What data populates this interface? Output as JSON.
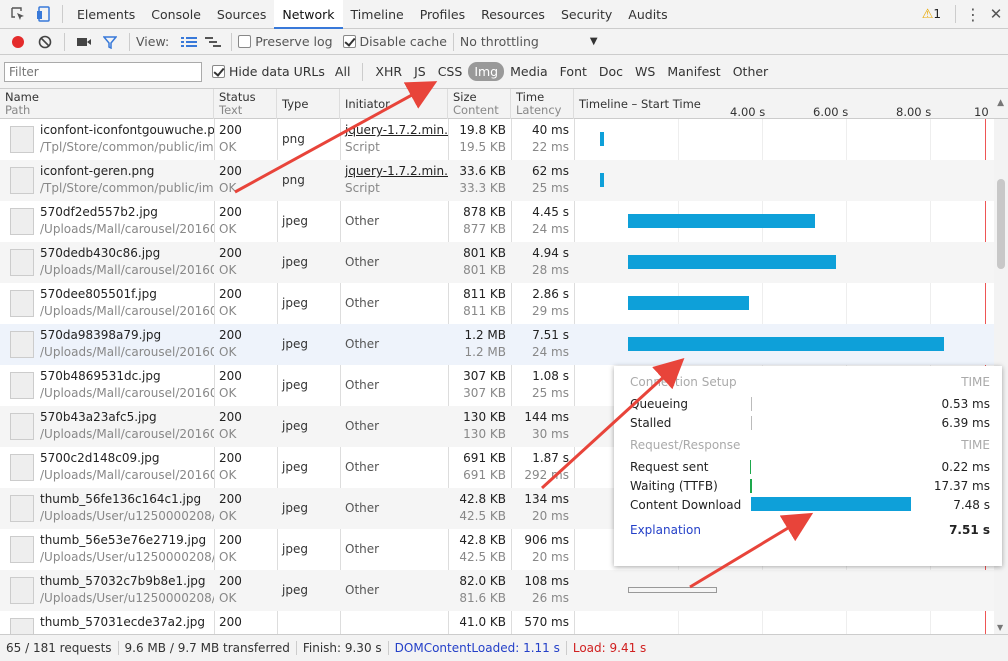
{
  "tabs": {
    "elements": "Elements",
    "console": "Console",
    "sources": "Sources",
    "network": "Network",
    "timeline": "Timeline",
    "profiles": "Profiles",
    "resources": "Resources",
    "security": "Security",
    "audits": "Audits",
    "warning_count": "1"
  },
  "toolbar": {
    "view_label": "View:",
    "preserve_log": "Preserve log",
    "disable_cache": "Disable cache",
    "throttling": "No throttling"
  },
  "filterbar": {
    "placeholder": "Filter",
    "hide_data_urls": "Hide data URLs",
    "types": [
      "All",
      "XHR",
      "JS",
      "CSS",
      "Img",
      "Media",
      "Font",
      "Doc",
      "WS",
      "Manifest",
      "Other"
    ],
    "selected": "Img"
  },
  "columns": {
    "name": "Name",
    "path": "Path",
    "status": "Status",
    "text": "Text",
    "type": "Type",
    "initiator": "Initiator",
    "size": "Size",
    "content": "Content",
    "time": "Time",
    "latency": "Latency",
    "timeline": "Timeline – Start Time",
    "ticks": [
      "4.00 s",
      "6.00 s",
      "8.00 s",
      "10"
    ]
  },
  "rows": [
    {
      "name": "iconfont-iconfontgouwuche.p...",
      "path": "/Tpl/Store/common/public/img",
      "status": "200",
      "text": "OK",
      "type": "png",
      "initiator": "jquery-1.7.2.min....",
      "init_sub": "Script",
      "size": "19.8 KB",
      "content": "19.5 KB",
      "time": "40 ms",
      "latency": "22 ms",
      "bar_start": 0.52,
      "bar_dur": 0.04
    },
    {
      "name": "iconfont-geren.png",
      "path": "/Tpl/Store/common/public/img",
      "status": "200",
      "text": "OK",
      "type": "png",
      "initiator": "jquery-1.7.2.min....",
      "init_sub": "Script",
      "size": "33.6 KB",
      "content": "33.3 KB",
      "time": "62 ms",
      "latency": "25 ms",
      "bar_start": 0.52,
      "bar_dur": 0.06
    },
    {
      "name": "570df2ed557b2.jpg",
      "path": "/Uploads/Mall/carousel/20160...",
      "status": "200",
      "text": "OK",
      "type": "jpeg",
      "initiator": "Other",
      "init_sub": "",
      "size": "878 KB",
      "content": "877 KB",
      "time": "4.45 s",
      "latency": "24 ms",
      "bar_start": 1.2,
      "bar_dur": 4.45
    },
    {
      "name": "570dedb430c86.jpg",
      "path": "/Uploads/Mall/carousel/20160...",
      "status": "200",
      "text": "OK",
      "type": "jpeg",
      "initiator": "Other",
      "init_sub": "",
      "size": "801 KB",
      "content": "801 KB",
      "time": "4.94 s",
      "latency": "28 ms",
      "bar_start": 1.2,
      "bar_dur": 4.94
    },
    {
      "name": "570dee805501f.jpg",
      "path": "/Uploads/Mall/carousel/20160...",
      "status": "200",
      "text": "OK",
      "type": "jpeg",
      "initiator": "Other",
      "init_sub": "",
      "size": "811 KB",
      "content": "811 KB",
      "time": "2.86 s",
      "latency": "29 ms",
      "bar_start": 1.2,
      "bar_dur": 2.86
    },
    {
      "name": "570da98398a79.jpg",
      "path": "/Uploads/Mall/carousel/20160...",
      "status": "200",
      "text": "OK",
      "type": "jpeg",
      "initiator": "Other",
      "init_sub": "",
      "size": "1.2 MB",
      "content": "1.2 MB",
      "time": "7.51 s",
      "latency": "24 ms",
      "bar_start": 1.2,
      "bar_dur": 7.51
    },
    {
      "name": "570b4869531dc.jpg",
      "path": "/Uploads/Mall/carousel/20160...",
      "status": "200",
      "text": "OK",
      "type": "jpeg",
      "initiator": "Other",
      "init_sub": "",
      "size": "307 KB",
      "content": "307 KB",
      "time": "1.08 s",
      "latency": "25 ms",
      "bar_start": null,
      "bar_dur": null
    },
    {
      "name": "570b43a23afc5.jpg",
      "path": "/Uploads/Mall/carousel/20160...",
      "status": "200",
      "text": "OK",
      "type": "jpeg",
      "initiator": "Other",
      "init_sub": "",
      "size": "130 KB",
      "content": "130 KB",
      "time": "144 ms",
      "latency": "30 ms",
      "bar_start": null,
      "bar_dur": null
    },
    {
      "name": "5700c2d148c09.jpg",
      "path": "/Uploads/Mall/carousel/20160...",
      "status": "200",
      "text": "OK",
      "type": "jpeg",
      "initiator": "Other",
      "init_sub": "",
      "size": "691 KB",
      "content": "691 KB",
      "time": "1.87 s",
      "latency": "292 ms",
      "bar_start": null,
      "bar_dur": null
    },
    {
      "name": "thumb_56fe136c164c1.jpg",
      "path": "/Uploads/User/u1250000208/...",
      "status": "200",
      "text": "OK",
      "type": "jpeg",
      "initiator": "Other",
      "init_sub": "",
      "size": "42.8 KB",
      "content": "42.5 KB",
      "time": "134 ms",
      "latency": "20 ms",
      "bar_start": null,
      "bar_dur": null
    },
    {
      "name": "thumb_56e53e76e2719.jpg",
      "path": "/Uploads/User/u1250000208/...",
      "status": "200",
      "text": "OK",
      "type": "jpeg",
      "initiator": "Other",
      "init_sub": "",
      "size": "42.8 KB",
      "content": "42.5 KB",
      "time": "906 ms",
      "latency": "20 ms",
      "bar_start": null,
      "bar_dur": null
    },
    {
      "name": "thumb_57032c7b9b8e1.jpg",
      "path": "/Uploads/User/u1250000208/...",
      "status": "200",
      "text": "OK",
      "type": "jpeg",
      "initiator": "Other",
      "init_sub": "",
      "size": "82.0 KB",
      "content": "81.6 KB",
      "time": "108 ms",
      "latency": "26 ms",
      "bar_start": 1.2,
      "bar_dur": 2.1
    },
    {
      "name": "thumb_57031ecde37a2.jpg",
      "path": "",
      "status": "200",
      "text": "",
      "type": "",
      "initiator": "",
      "init_sub": "",
      "size": "41.0 KB",
      "content": "",
      "time": "570 ms",
      "latency": "",
      "bar_start": null,
      "bar_dur": null
    }
  ],
  "popup": {
    "connection_setup": "Connection Setup",
    "time_header": "TIME",
    "queueing": "Queueing",
    "queueing_val": "0.53 ms",
    "stalled": "Stalled",
    "stalled_val": "6.39 ms",
    "request_response": "Request/Response",
    "time_header2": "TIME",
    "request_sent": "Request sent",
    "request_sent_val": "0.22 ms",
    "waiting": "Waiting (TTFB)",
    "waiting_val": "17.37 ms",
    "content_download": "Content Download",
    "content_download_val": "7.48 s",
    "explanation": "Explanation",
    "total": "7.51 s"
  },
  "status": {
    "requests": "65 / 181 requests",
    "transferred": "9.6 MB / 9.7 MB transferred",
    "finish": "Finish: 9.30 s",
    "dcl": "DOMContentLoaded: 1.11 s",
    "load": "Load: 9.41 s"
  },
  "colors": {
    "accent": "#3879d9",
    "bar": "#0ea0d9",
    "arrow": "#e8443a",
    "dcl": "#2440c8",
    "load": "#d02020"
  }
}
